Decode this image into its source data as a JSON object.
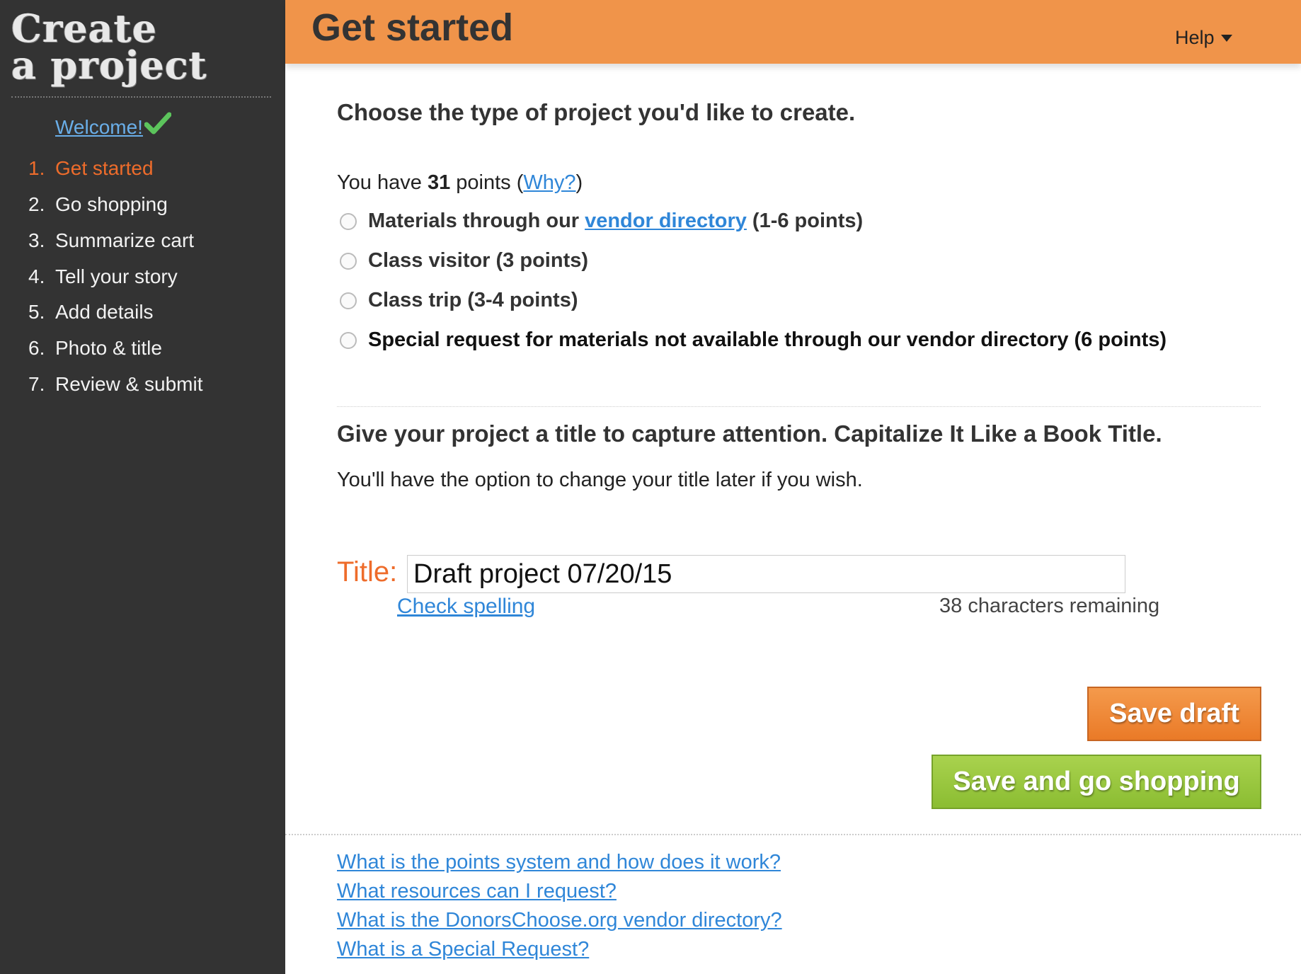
{
  "sidebar": {
    "title_line1": "Create",
    "title_line2": "a project",
    "welcome": "Welcome!",
    "steps": [
      {
        "num": "1.",
        "label": "Get started"
      },
      {
        "num": "2.",
        "label": "Go shopping"
      },
      {
        "num": "3.",
        "label": "Summarize cart"
      },
      {
        "num": "4.",
        "label": "Tell your story"
      },
      {
        "num": "5.",
        "label": "Add details"
      },
      {
        "num": "6.",
        "label": "Photo & title"
      },
      {
        "num": "7.",
        "label": "Review & submit"
      }
    ]
  },
  "header": {
    "title": "Get started",
    "help": "Help"
  },
  "project_type": {
    "heading": "Choose the type of project you'd like to create.",
    "points_prefix": "You have ",
    "points_value": "31",
    "points_suffix": " points (",
    "why_link": "Why?",
    "points_close": ")",
    "options": {
      "materials_prefix": "Materials through our",
      "materials_link": "vendor directory",
      "materials_suffix": "(1-6 points)",
      "class_visitor": "Class visitor (3 points)",
      "class_trip": "Class trip (3-4 points)",
      "special_request": "Special request for materials not available through our vendor directory (6 points)"
    }
  },
  "title_section": {
    "heading": "Give your project a title to capture attention. Capitalize It Like a Book Title.",
    "subtext": "You'll have the option to change your title later if you wish.",
    "label": "Title:",
    "value": "Draft project 07/20/15",
    "check_spelling": "Check spelling",
    "chars_remaining": "38 characters remaining"
  },
  "buttons": {
    "save_draft": "Save draft",
    "save_and_shop": "Save and go shopping"
  },
  "faq": [
    "What is the points system and how does it work?",
    "What resources can I request?",
    "What is the DonorsChoose.org vendor directory?",
    "What is a Special Request?"
  ],
  "colors": {
    "sidebar_bg": "#333333",
    "header_bg": "#f0944a",
    "accent_orange": "#ee6c2b",
    "link_blue": "#2f86d8",
    "check_green": "#5cc45c",
    "draft_button": "#ea7a27",
    "shop_button": "#8bbd32"
  }
}
